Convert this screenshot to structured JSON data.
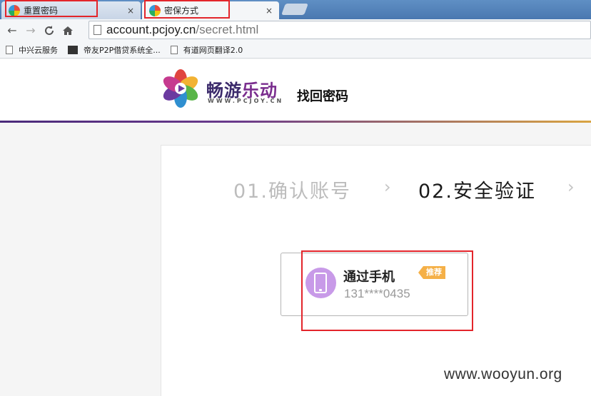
{
  "browser": {
    "tabs": [
      {
        "title": "重置密码",
        "close": "×",
        "state": "inactive"
      },
      {
        "title": "密保方式",
        "close": "×",
        "state": "active"
      }
    ],
    "nav": {
      "back": "←",
      "forward": "→",
      "reload": "C",
      "home": "⌂"
    },
    "address": {
      "host": "account.pcjoy.cn",
      "path": "/secret.html"
    },
    "bookmarks": [
      "中兴云服务",
      "帝友P2P借贷系统全...",
      "有道网页翻译2.0"
    ]
  },
  "site": {
    "logo_name_main": "畅游",
    "logo_name_accent": "乐动",
    "logo_domain": "WWW.PCJOY.CN",
    "page_heading": "找回密码"
  },
  "steps": [
    {
      "label": "01.确认账号",
      "state": "done"
    },
    {
      "label": "02.安全验证",
      "state": "current"
    }
  ],
  "step_separator": "›",
  "verify_option": {
    "title": "通过手机",
    "phone": "131****0435",
    "badge": "推荐"
  },
  "watermark": "www.wooyun.org",
  "colors": {
    "highlight_box": "#e3252b",
    "badge": "#f5b047",
    "phone_icon": "#c89ae8",
    "brand_purple": "#3b2a6b"
  }
}
